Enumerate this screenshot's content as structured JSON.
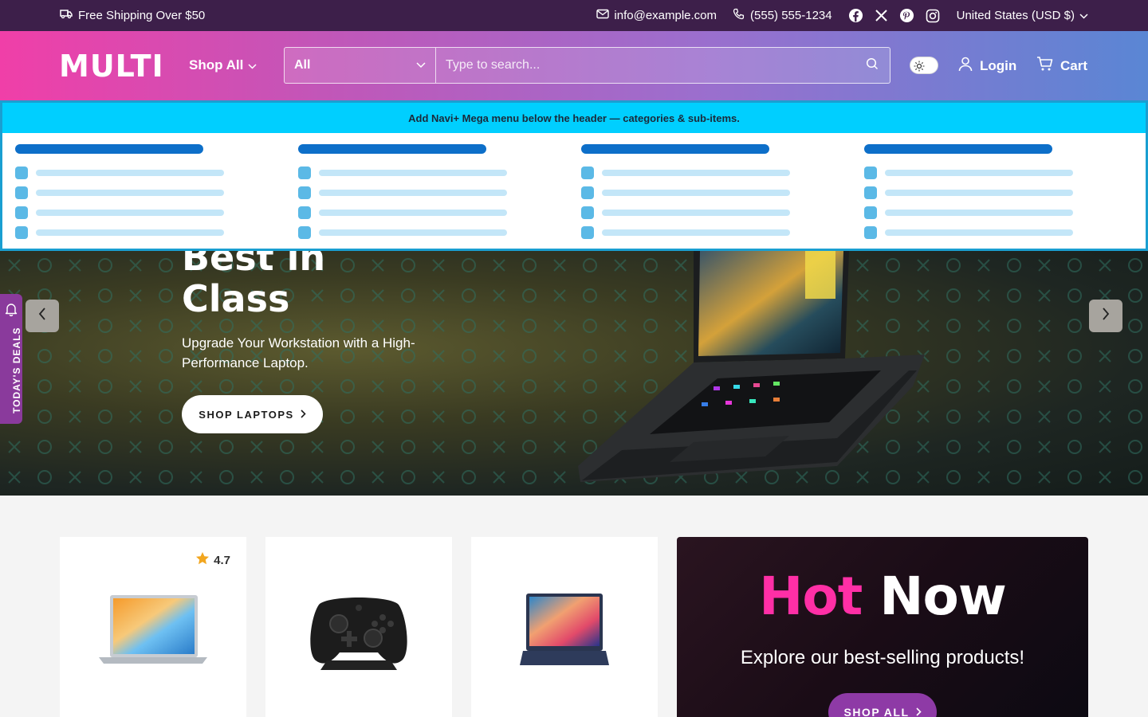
{
  "topbar": {
    "shipping": "Free Shipping Over $50",
    "email": "info@example.com",
    "phone": "(555) 555-1234",
    "socials": [
      "facebook-icon",
      "x-icon",
      "pinterest-icon",
      "instagram-icon"
    ],
    "region": "United States (USD $)"
  },
  "header": {
    "logo": "MULTI",
    "shop_all": "Shop All",
    "search_category": "All",
    "search_placeholder": "Type to search...",
    "login": "Login",
    "cart": "Cart"
  },
  "mega_menu": {
    "notice": "Add Navi+ Mega menu below the header — categories & sub-items."
  },
  "hero": {
    "heading_line1": "Best in",
    "heading_line2": "Class",
    "subtitle": "Upgrade Your Workstation with a High-Performance Laptop.",
    "cta": "SHOP LAPTOPS"
  },
  "deals_tab": "TODAY'S DEALS",
  "products": [
    {
      "rating": "4.7",
      "icon": "laptop-image"
    },
    {
      "rating": "",
      "icon": "game-controller-image"
    },
    {
      "rating": "",
      "icon": "laptop-image"
    }
  ],
  "promo": {
    "title_part1": "Hot",
    "title_part2": "Now",
    "subtitle": "Explore our best-selling products!",
    "cta": "SHOP ALL"
  },
  "colors": {
    "topbar": "#3d1f4a",
    "accent_pink": "#ff2fa6",
    "accent_purple": "#8e3aa6",
    "mega_bar": "#00cfff"
  }
}
